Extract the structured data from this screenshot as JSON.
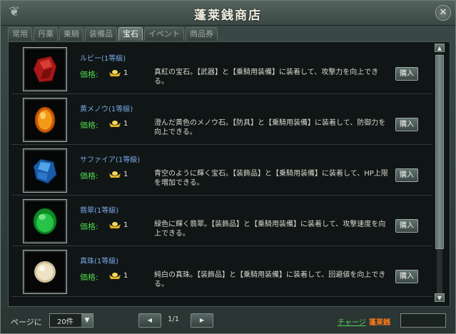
{
  "window": {
    "title": "蓬莱銭商店"
  },
  "tabs": [
    {
      "label": "常用"
    },
    {
      "label": "丹薬"
    },
    {
      "label": "乗騎"
    },
    {
      "label": "装備品"
    },
    {
      "label": "宝石"
    },
    {
      "label": "イベント"
    },
    {
      "label": "商品券"
    }
  ],
  "active_tab": "宝石",
  "price_label": "価格:",
  "buy_label": "購入",
  "items": [
    {
      "name": "ルビー(1等級)",
      "price": "1",
      "icon": "ruby-icon",
      "color": "#c0241c",
      "desc": "真紅の宝石。【武器】と【乗騎用装備】に装着して、攻撃力を向上できる。"
    },
    {
      "name": "黄メノウ(1等級)",
      "price": "1",
      "icon": "yellow-agate-icon",
      "color": "#f08a10",
      "desc": "澄んだ黄色のメノウ石。【防具】と【乗騎用装備】に装着して、防御力を向上できる。"
    },
    {
      "name": "サファイア(1等級)",
      "price": "1",
      "icon": "sapphire-icon",
      "color": "#3a86d8",
      "desc": "青空のように輝く宝石。【装飾品】と【乗騎用装備】に装着して、HP上限を増加できる。"
    },
    {
      "name": "翡翠(1等級)",
      "price": "1",
      "icon": "jade-icon",
      "color": "#22b040",
      "desc": "緑色に輝く翡翠。【装飾品】と【乗騎用装備】に装着して、攻撃速度を向上できる。"
    },
    {
      "name": "真珠(1等級)",
      "price": "1",
      "icon": "pearl-icon",
      "color": "#e8dcc0",
      "desc": "純白の真珠。【装飾品】と【乗騎用装備】に装着して、回避値を向上できる。"
    }
  ],
  "footer": {
    "page_size_label": "ページに",
    "page_size_value": "20件",
    "page_info": "1/1",
    "charge_label": "チャージ",
    "currency_label": "蓬莱銭",
    "balance": ""
  }
}
